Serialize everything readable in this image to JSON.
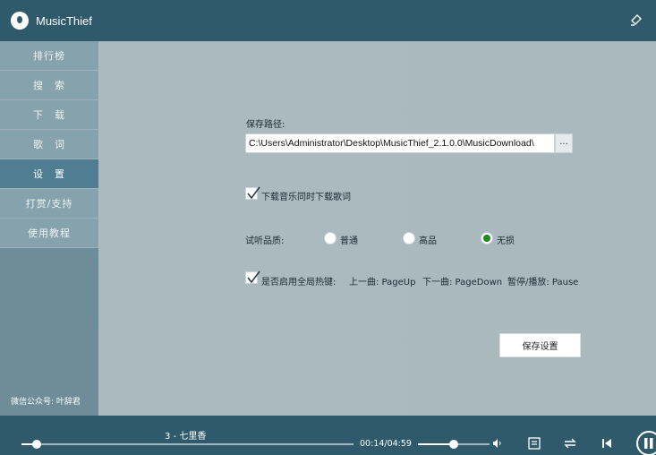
{
  "app": {
    "title": "MusicThief"
  },
  "sidebar": {
    "items": [
      {
        "label": "排行榜",
        "active": false
      },
      {
        "label": "搜　索",
        "active": false
      },
      {
        "label": "下　载",
        "active": false
      },
      {
        "label": "歌　词",
        "active": false
      },
      {
        "label": "设　置",
        "active": true
      },
      {
        "label": "打赏/支持",
        "active": false
      },
      {
        "label": "使用教程",
        "active": false
      }
    ],
    "footer": "微信公众号: 叶辞君"
  },
  "settings": {
    "save_path_label": "保存路径:",
    "save_path_value": "C:\\Users\\Administrator\\Desktop\\MusicThief_2.1.0.0\\MusicDownload\\",
    "browse_label": "...",
    "download_lyrics_label": "下载音乐同时下载歌词",
    "download_lyrics_checked": true,
    "quality_label": "试听品质:",
    "quality_options": [
      "普通",
      "高品",
      "无损"
    ],
    "quality_selected": "无损",
    "hotkey_label": "是否启用全局热键:",
    "hotkey_checked": true,
    "hotkey_prev": "上一曲: PageUp",
    "hotkey_next": "下一曲: PageDown",
    "hotkey_pause": "暂停/播放: Pause",
    "save_button": "保存设置"
  },
  "player": {
    "track": "3 - 七里香",
    "time": "00:14/04:59",
    "progress": 0.047,
    "volume": 0.5
  },
  "colors": {
    "titlebar": "#2f5a6b",
    "sidebar_active": "#4f7d92",
    "radio_selected": "#1b8a1b"
  }
}
